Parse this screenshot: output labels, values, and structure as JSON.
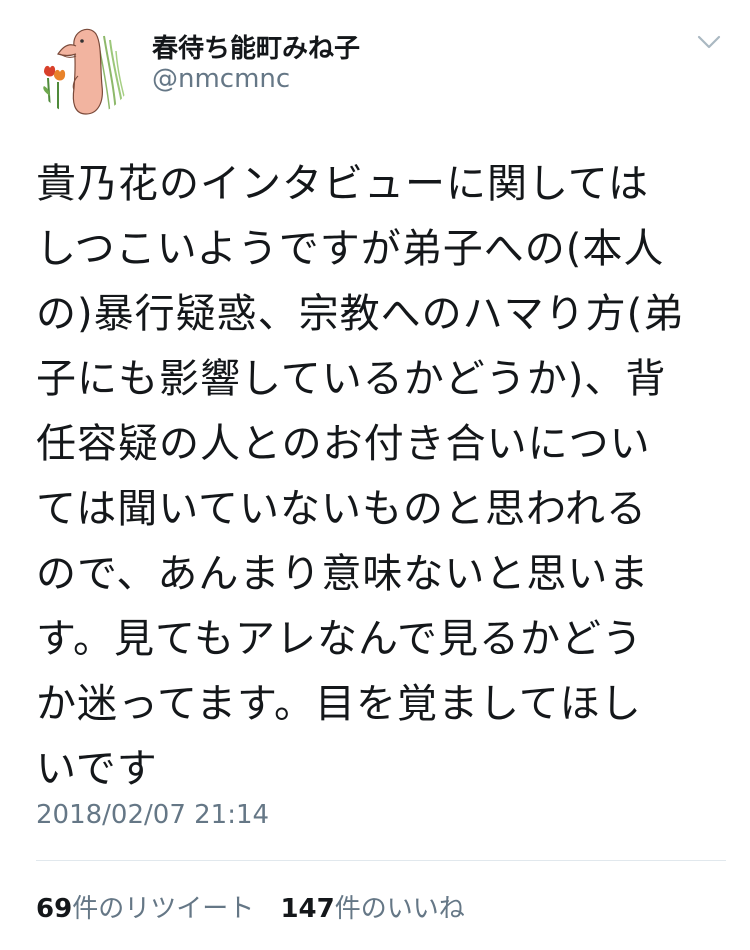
{
  "user": {
    "display_name": "春待ち能町みね子",
    "handle": "@nmcmnc",
    "avatar_icon": "cartoon-creature-with-tulips"
  },
  "menu": {
    "icon": "chevron-down-icon"
  },
  "tweet": {
    "lines": [
      "貴乃花のインタビューに関しては",
      "しつこいようですが弟子への(本人",
      "の)暴行疑惑、宗教へのハマり方(弟",
      "子にも影響しているかどうか)、背",
      "任容疑の人とのお付き合いについ",
      "ては聞いていないものと思われる",
      "ので、あんまり意味ないと思いま",
      "す。見てもアレなんで見るかどう",
      "か迷ってます。目を覚ましてほし",
      "いです"
    ],
    "timestamp": "2018/02/07 21:14"
  },
  "stats": {
    "retweets_count": "69",
    "retweets_label": "件のリツイート",
    "likes_count": "147",
    "likes_label": "件のいいね"
  },
  "colors": {
    "text": "#14171a",
    "secondary": "#657786",
    "divider": "#e1e8ed"
  }
}
